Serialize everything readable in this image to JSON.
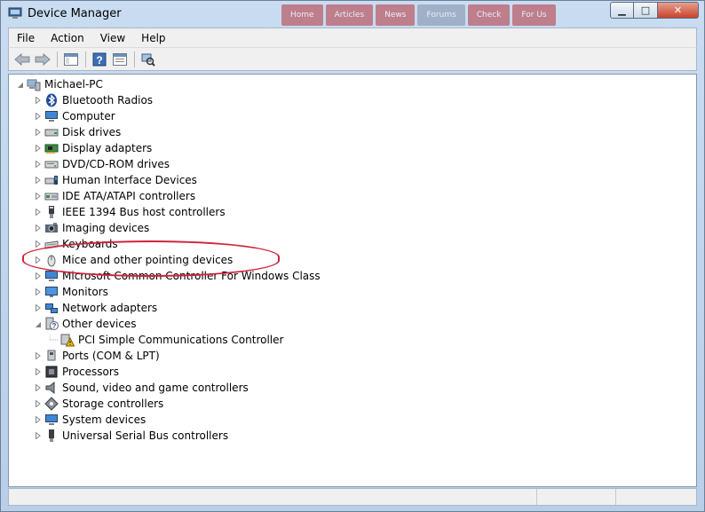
{
  "window": {
    "title": "Device Manager"
  },
  "background_tabs": [
    "Home",
    "Articles",
    "News",
    "Forums",
    "Check",
    "For Us"
  ],
  "caption_buttons": {
    "minimize": "▁",
    "maximize": "□",
    "close": "✕"
  },
  "menu": [
    "File",
    "Action",
    "View",
    "Help"
  ],
  "toolbar": {
    "buttons": [
      "back-icon",
      "forward-icon",
      "show-hide-console-tree-icon",
      "help-icon",
      "properties-icon",
      "scan-hardware-icon"
    ]
  },
  "tree": {
    "root": "Michael-PC",
    "categories": [
      {
        "label": "Bluetooth Radios",
        "icon": "bluetooth-icon"
      },
      {
        "label": "Computer",
        "icon": "computer-icon"
      },
      {
        "label": "Disk drives",
        "icon": "disk-drive-icon"
      },
      {
        "label": "Display adapters",
        "icon": "display-adapter-icon"
      },
      {
        "label": "DVD/CD-ROM drives",
        "icon": "dvd-drive-icon"
      },
      {
        "label": "Human Interface Devices",
        "icon": "hid-icon"
      },
      {
        "label": "IDE ATA/ATAPI controllers",
        "icon": "ide-controller-icon"
      },
      {
        "label": "IEEE 1394 Bus host controllers",
        "icon": "ieee1394-icon"
      },
      {
        "label": "Imaging devices",
        "icon": "imaging-device-icon"
      },
      {
        "label": "Keyboards",
        "icon": "keyboard-icon"
      },
      {
        "label": "Mice and other pointing devices",
        "icon": "mouse-icon"
      },
      {
        "label": "Microsoft Common Controller For Windows Class",
        "icon": "controller-class-icon"
      },
      {
        "label": "Monitors",
        "icon": "monitor-icon"
      },
      {
        "label": "Network adapters",
        "icon": "network-adapter-icon"
      },
      {
        "label": "Other devices",
        "icon": "unknown-device-icon",
        "expanded": true
      },
      {
        "label": "PCI Simple Communications Controller",
        "icon": "warning-device-icon",
        "child": true
      },
      {
        "label": "Ports (COM & LPT)",
        "icon": "port-icon"
      },
      {
        "label": "Processors",
        "icon": "processor-icon"
      },
      {
        "label": "Sound, video and game controllers",
        "icon": "sound-icon"
      },
      {
        "label": "Storage controllers",
        "icon": "storage-controller-icon"
      },
      {
        "label": "System devices",
        "icon": "system-device-icon"
      },
      {
        "label": "Universal Serial Bus controllers",
        "icon": "usb-icon"
      }
    ]
  },
  "colors": {
    "highlight_ring": "#d0243a",
    "warning": "#f2c200"
  }
}
